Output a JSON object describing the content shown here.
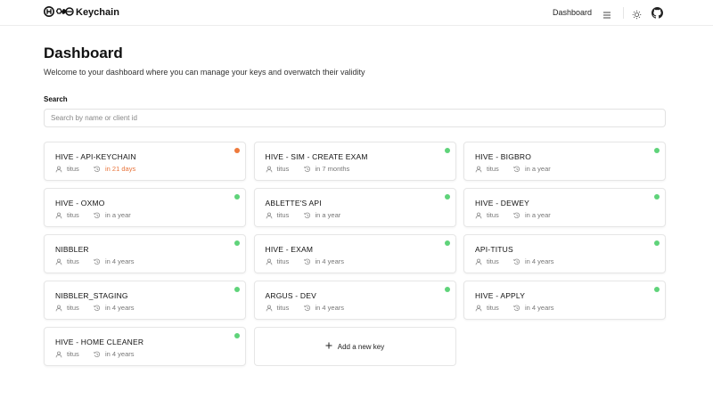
{
  "header": {
    "brand": "Keychain",
    "nav_dashboard": "Dashboard"
  },
  "main": {
    "title": "Dashboard",
    "subtitle": "Welcome to your dashboard where you can manage your keys and overwatch their validity",
    "search_label": "Search",
    "search_placeholder": "Search by name or client id"
  },
  "colors": {
    "status_ok": "#5fd37a",
    "status_warn": "#ee7a3c"
  },
  "keys": [
    {
      "name": "HIVE - API-KEYCHAIN",
      "owner": "titus",
      "expiry": "in 21 days",
      "status": "warn"
    },
    {
      "name": "HIVE - SIM - CREATE EXAM",
      "owner": "titus",
      "expiry": "in 7 months",
      "status": "ok"
    },
    {
      "name": "HIVE - BIGBRO",
      "owner": "titus",
      "expiry": "in a year",
      "status": "ok"
    },
    {
      "name": "HIVE - OXMO",
      "owner": "titus",
      "expiry": "in a year",
      "status": "ok"
    },
    {
      "name": "ABLETTE'S API",
      "owner": "titus",
      "expiry": "in a year",
      "status": "ok"
    },
    {
      "name": "HIVE - DEWEY",
      "owner": "titus",
      "expiry": "in a year",
      "status": "ok"
    },
    {
      "name": "NIBBLER",
      "owner": "titus",
      "expiry": "in 4 years",
      "status": "ok"
    },
    {
      "name": "HIVE - EXAM",
      "owner": "titus",
      "expiry": "in 4 years",
      "status": "ok"
    },
    {
      "name": "API-TITUS",
      "owner": "titus",
      "expiry": "in 4 years",
      "status": "ok"
    },
    {
      "name": "NIBBLER_STAGING",
      "owner": "titus",
      "expiry": "in 4 years",
      "status": "ok"
    },
    {
      "name": "ARGUS - DEV",
      "owner": "titus",
      "expiry": "in 4 years",
      "status": "ok"
    },
    {
      "name": "HIVE - APPLY",
      "owner": "titus",
      "expiry": "in 4 years",
      "status": "ok"
    },
    {
      "name": "HIVE - HOME CLEANER",
      "owner": "titus",
      "expiry": "in 4 years",
      "status": "ok"
    }
  ],
  "add_key_label": "Add a new key"
}
